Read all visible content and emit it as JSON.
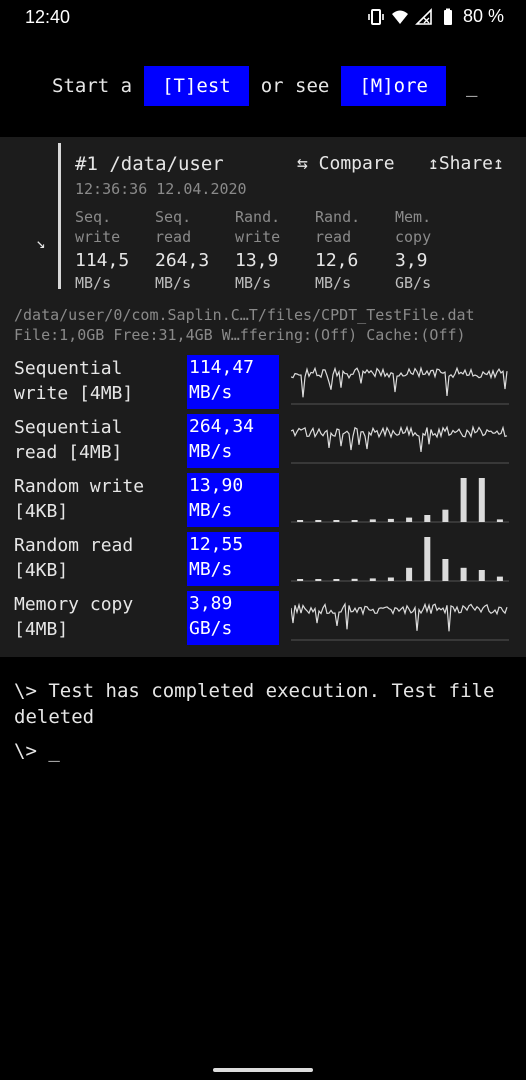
{
  "status_bar": {
    "time": "12:40",
    "battery": "80 %",
    "icons": [
      "vibrate-icon",
      "wifi-icon",
      "signal-icon",
      "battery-icon"
    ]
  },
  "top": {
    "prefix": "Start a",
    "test_button": "[T]est",
    "middle": "or see",
    "more_button": "[M]ore",
    "cursor": "_"
  },
  "result": {
    "title": "#1 /data/user",
    "compare": "⇆ Compare",
    "share": "↥Share↥",
    "datetime": "12:36:36 12.04.2020",
    "side_arrow": "↘",
    "metrics": [
      {
        "l1": "Seq.",
        "l2": "write",
        "value": "114,5",
        "unit": "MB/s"
      },
      {
        "l1": "Seq.",
        "l2": "read",
        "value": "264,3",
        "unit": "MB/s"
      },
      {
        "l1": "Rand.",
        "l2": "write",
        "value": "13,9",
        "unit": "MB/s"
      },
      {
        "l1": "Rand.",
        "l2": "read",
        "value": "12,6",
        "unit": "MB/s"
      },
      {
        "l1": "Mem.",
        "l2": "copy",
        "value": "3,9",
        "unit": "GB/s"
      }
    ]
  },
  "file_info": {
    "path": "/data/user/0/com.Saplin.C…T/files/CPDT_TestFile.dat",
    "details": "File:1,0GB Free:31,4GB W…ffering:(Off) Cache:(Off)"
  },
  "tests": [
    {
      "line1": "Sequential",
      "line2": "write [4MB]",
      "value": "114,47",
      "unit": "MB/s",
      "graph": "line"
    },
    {
      "line1": "Sequential",
      "line2": "read [4MB]",
      "value": "264,34",
      "unit": "MB/s",
      "graph": "line"
    },
    {
      "line1": "Random write",
      "line2": "[4KB]",
      "value": "13,90",
      "unit": "MB/s",
      "graph": "bars",
      "bars": [
        0.03,
        0.04,
        0.04,
        0.04,
        0.06,
        0.07,
        0.1,
        0.16,
        0.28,
        1.0,
        1.0,
        0.06
      ]
    },
    {
      "line1": "Random read",
      "line2": "[4KB]",
      "value": "12,55",
      "unit": "MB/s",
      "graph": "bars",
      "bars": [
        0.03,
        0.04,
        0.04,
        0.05,
        0.06,
        0.08,
        0.3,
        1.0,
        0.5,
        0.3,
        0.25,
        0.1
      ]
    },
    {
      "line1": "Memory copy",
      "line2": "[4MB]",
      "value": "3,89",
      "unit": "GB/s",
      "graph": "line"
    }
  ],
  "console": {
    "message": "\\> Test has completed execution. Test file deleted",
    "prompt": "\\> _"
  }
}
